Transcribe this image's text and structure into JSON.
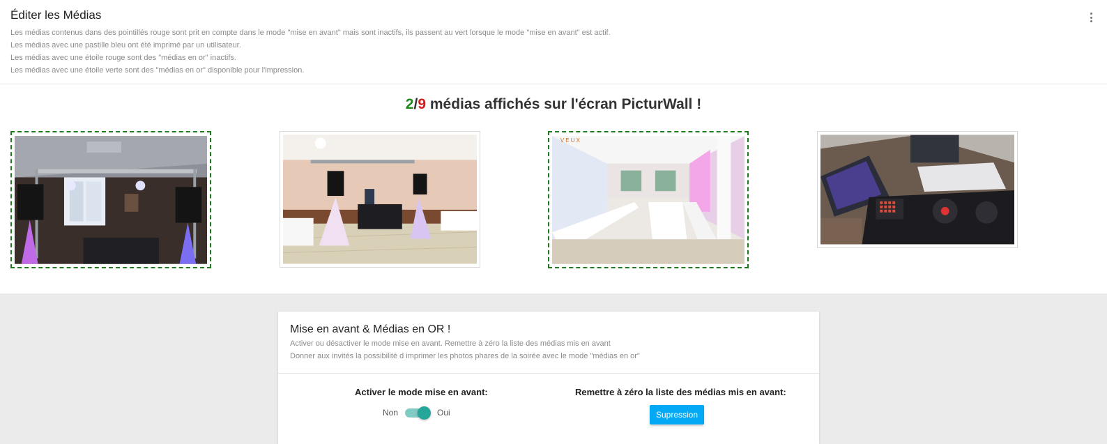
{
  "header": {
    "title": "Éditer les Médias",
    "lines": [
      "Les médias contenus dans des pointillés rouge sont prit en compte dans le mode \"mise en avant\" mais sont inactifs, ils passent au vert lorsque le mode \"mise en avant\" est actif.",
      "Les médias avec une pastille bleu ont été imprimé par un utilisateur.",
      "Les médias avec une étoile rouge sont des \"médias en or\" inactifs.",
      "Les médias avec une étoile verte sont des \"médias en or\" disponible pour l'impression."
    ]
  },
  "counter": {
    "shown": "2",
    "sep": "/",
    "total": "9",
    "suffix": " médias affichés sur l'écran PicturWall !"
  },
  "media": [
    {
      "featured": true,
      "scene": "dj-stage-dark"
    },
    {
      "featured": false,
      "scene": "dj-stage-hall"
    },
    {
      "featured": true,
      "scene": "banquet-hall"
    },
    {
      "featured": false,
      "scene": "dj-controller"
    }
  ],
  "colors": {
    "featured_border": "#1d7a1d",
    "count_green": "#1a8a1a",
    "count_red": "#d41c1c",
    "toggle_on": "#26a69a",
    "button": "#03a9f4"
  },
  "settings": {
    "title": "Mise en avant & Médias en OR !",
    "desc1": "Activer ou désactiver le mode mise en avant. Remettre à zéro la liste des médias mis en avant",
    "desc2": "Donner aux invités la possibilité d imprimer les photos phares de la soirée avec le mode \"médias en or\"",
    "toggle_label": "Activer le mode mise en avant:",
    "off_label": "Non",
    "on_label": "Oui",
    "toggle_on": true,
    "reset_label": "Remettre à zéro la liste des médias mis en avant:",
    "reset_button": "Supression"
  }
}
